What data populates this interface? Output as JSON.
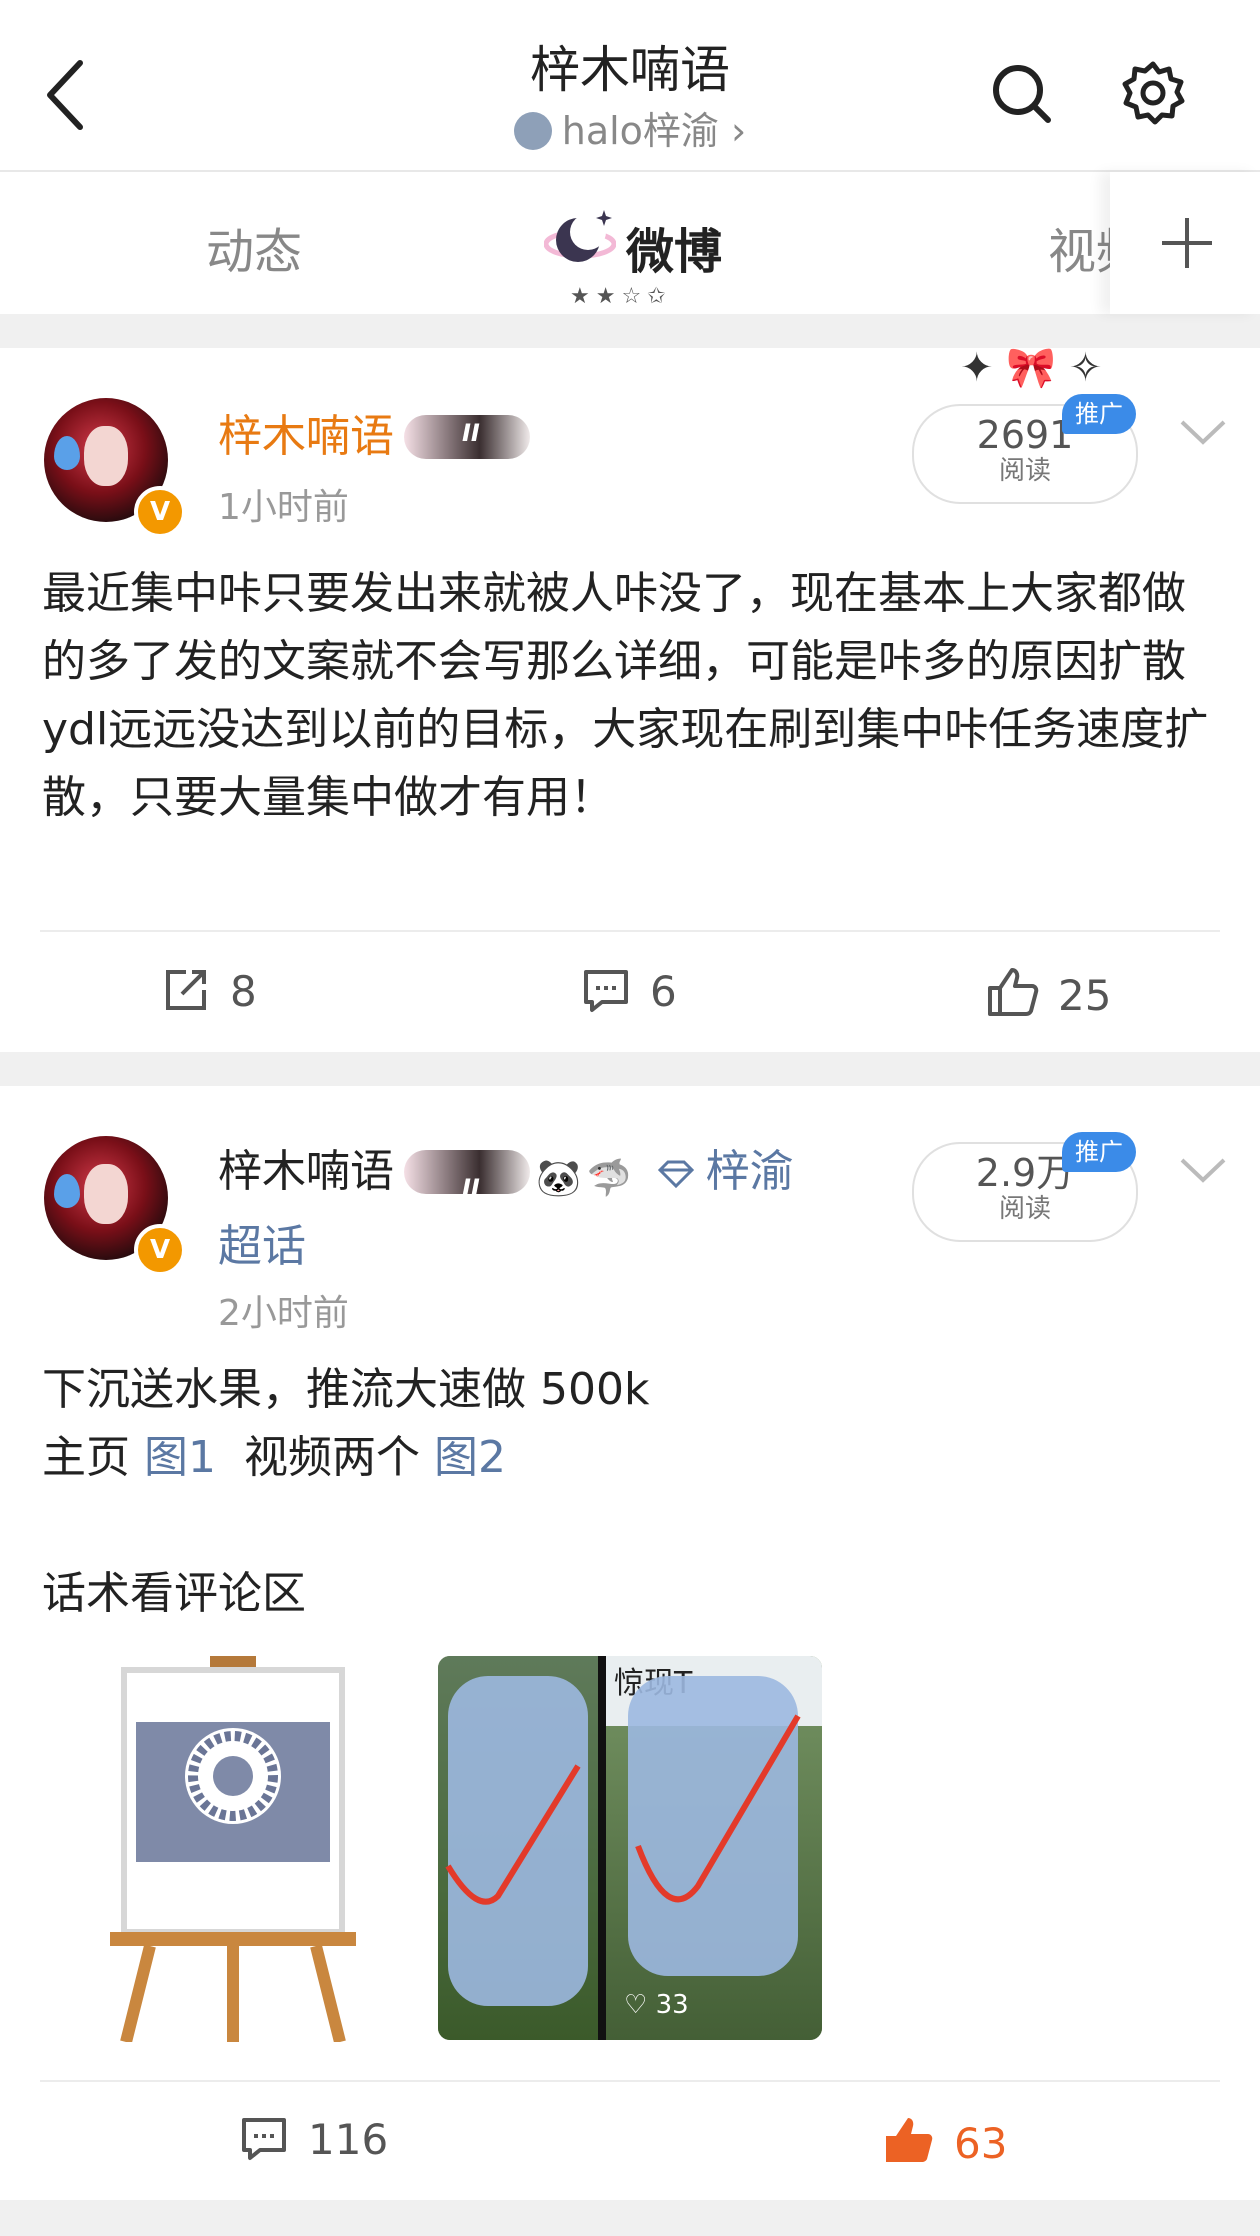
{
  "header": {
    "title": "梓木喃语",
    "subtitle": "halo梓渝",
    "subtitle_chevron": "›",
    "icons": [
      "back-icon",
      "search-icon",
      "gear-icon"
    ]
  },
  "tabs": [
    {
      "label": "动态",
      "active": false
    },
    {
      "label": "微博",
      "active": true
    },
    {
      "label": "视频",
      "active": false
    }
  ],
  "tabs_add": "+",
  "posts": [
    {
      "author": "梓木喃语",
      "badge_text": "II",
      "time": "1小时前",
      "read_count": "2691",
      "read_label": "阅读",
      "promo_label": "推广",
      "body": "最近集中咔只要发出来就被人咔没了，现在基本上大家都做的多了发的文案就不会写那么详细，可能是咔多的原因扩散ydl远远没达到以前的目标，大家现在刷到集中咔任务速度扩散，只要大量集中做才有用！",
      "repost_count": "8",
      "comment_count": "6",
      "like_count": "25",
      "liked": false
    },
    {
      "author": "梓木喃语",
      "badge_text": "II",
      "emojis": [
        "🐼",
        "🦈"
      ],
      "super_topic_line1": "梓渝",
      "super_topic_line2": "超话",
      "time": "2小时前",
      "read_count": "2.9万",
      "read_label": "阅读",
      "promo_label": "推广",
      "body_line1": "下沉送水果，推流大速做 500k",
      "body_line2_prefix": "主页",
      "body_line2_link1": "图1",
      "body_line2_middle": "视频两个",
      "body_line2_link2": "图2",
      "body_line3": "话术看评论区",
      "image2_overlay_text": "惊现T",
      "image2_likes": "33",
      "comment_count": "116",
      "like_count": "63",
      "liked": true
    }
  ],
  "colors": {
    "author_highlight": "#e87a12",
    "link": "#5b78a3",
    "like_active": "#ec6224",
    "promo_blue": "#3b8be8"
  }
}
